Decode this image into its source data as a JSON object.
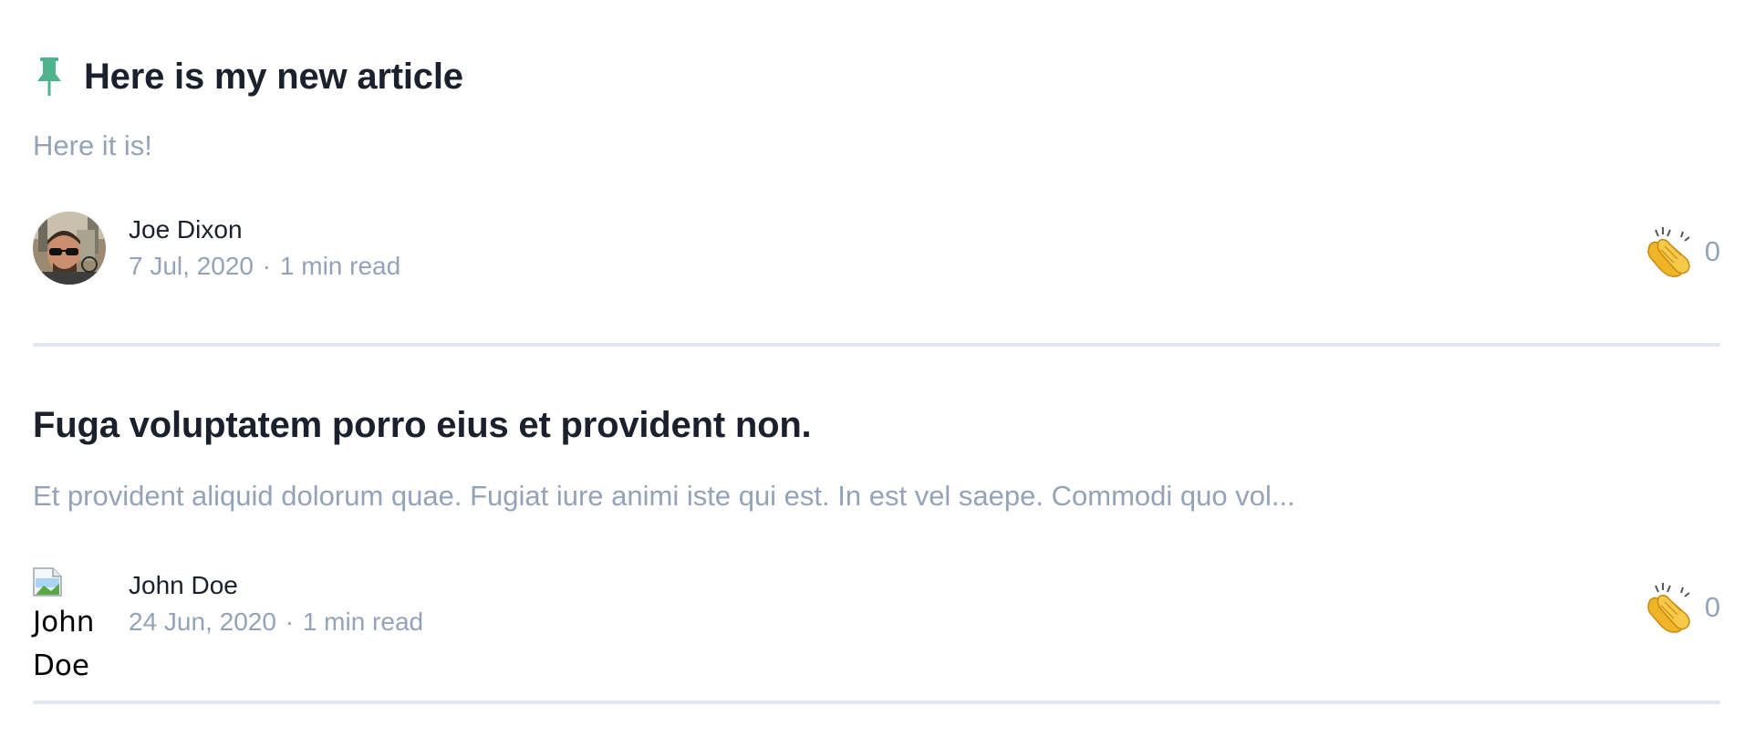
{
  "colors": {
    "accent": "#4fb38f",
    "title": "#1a202c",
    "muted": "#94a3b8",
    "divider": "#e2e8f0"
  },
  "articles": [
    {
      "pinned": true,
      "pin_icon": "pin-icon",
      "title": "Here is my new article",
      "excerpt": "Here it is!",
      "author": "Joe Dixon",
      "date": "7 Jul, 2020",
      "separator": "·",
      "read_time": "1 min read",
      "avatar": "photo",
      "clap_icon": "clapping-hands-icon",
      "claps": "0"
    },
    {
      "pinned": false,
      "title": "Fuga voluptatem porro eius et provident non.",
      "excerpt": "Et provident aliquid dolorum quae. Fugiat iure animi iste qui est. In est vel saepe. Commodi quo vol...",
      "author": "John Doe",
      "date": "24 Jun, 2020",
      "separator": "·",
      "read_time": "1 min read",
      "avatar": "broken-image",
      "avatar_alt": "John Doe",
      "clap_icon": "clapping-hands-icon",
      "claps": "0"
    }
  ]
}
